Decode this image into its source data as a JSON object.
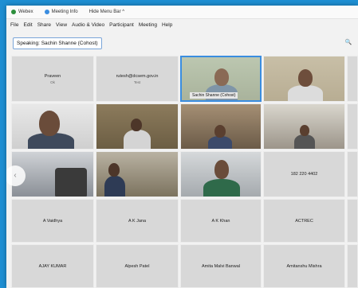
{
  "titlebar": {
    "app": "Webex",
    "meeting_info": "Meeting Info",
    "hide_menu": "Hide Menu Bar ^"
  },
  "menu": [
    "File",
    "Edit",
    "Share",
    "View",
    "Audio & Video",
    "Participant",
    "Meeting",
    "Help"
  ],
  "speaking": "Speaking: Sachin Shanne (Cohost)",
  "active_speaker_label": "Sachin Shanne (Cohost)",
  "participants_text": [
    {
      "name": "Praveen",
      "sub": "Ok"
    },
    {
      "name": "rutesh@dcsem.gov.in",
      "sub": "Test"
    },
    {
      "name": "182 220 4402",
      "sub": ""
    },
    {
      "name": "A Vaidhya",
      "sub": ""
    },
    {
      "name": "A K Jana",
      "sub": ""
    },
    {
      "name": "A K Khan",
      "sub": ""
    },
    {
      "name": "ACTREC",
      "sub": ""
    },
    {
      "name": "AJAY KUMAR",
      "sub": ""
    },
    {
      "name": "Alpesh Patel",
      "sub": ""
    },
    {
      "name": "Amita Malvi Banwal",
      "sub": ""
    },
    {
      "name": "Amitanshu Mishra",
      "sub": ""
    }
  ],
  "colors": {
    "accent": "#3a8de0",
    "background": "#1e8fd3"
  }
}
